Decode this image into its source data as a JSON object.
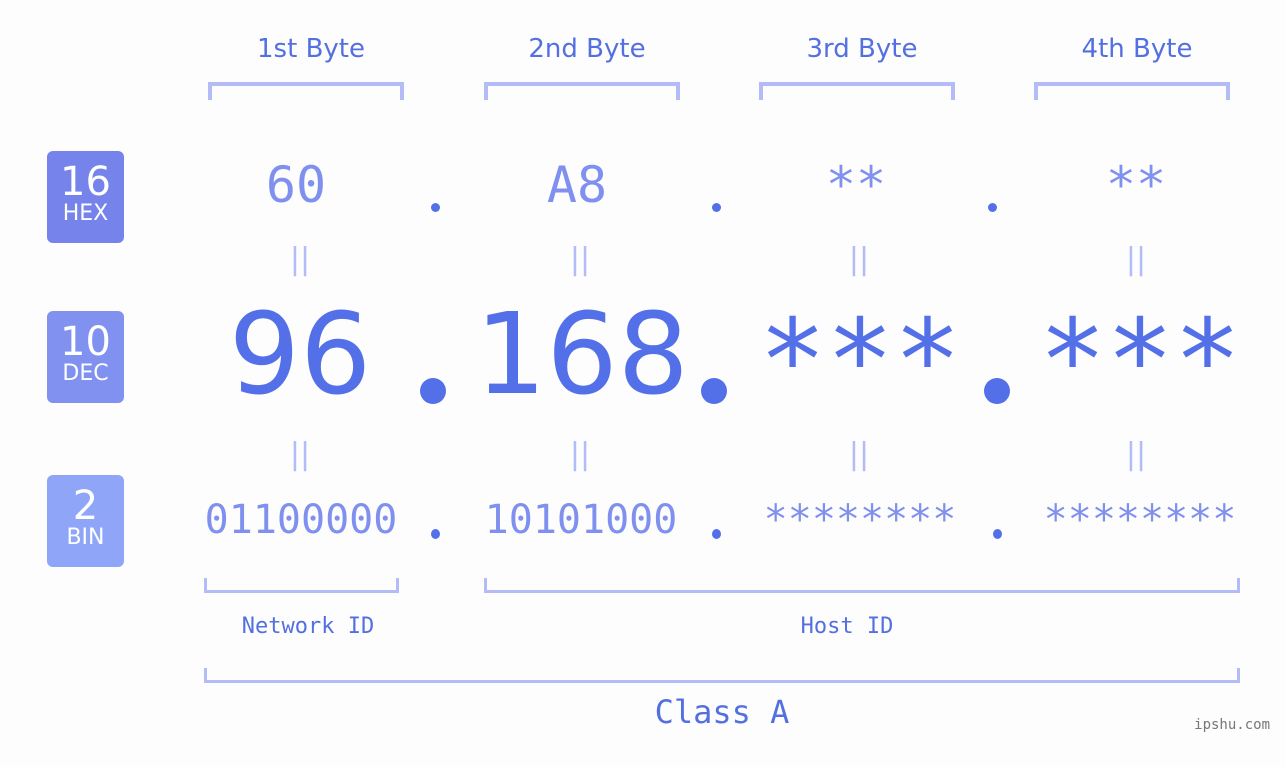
{
  "bytes": [
    {
      "header": "1st Byte",
      "hex": "60",
      "dec": "96",
      "bin": "01100000"
    },
    {
      "header": "2nd Byte",
      "hex": "A8",
      "dec": "168",
      "bin": "10101000"
    },
    {
      "header": "3rd Byte",
      "hex": "**",
      "dec": "***",
      "bin": "********"
    },
    {
      "header": "4th Byte",
      "hex": "**",
      "dec": "***",
      "bin": "********"
    }
  ],
  "badges": {
    "hex": {
      "number": "16",
      "label": "HEX",
      "color": "#7583ea"
    },
    "dec": {
      "number": "10",
      "label": "DEC",
      "color": "#8091f0"
    },
    "bin": {
      "number": "2",
      "label": "BIN",
      "color": "#8fa6f8"
    }
  },
  "equals_symbol": "||",
  "segments": {
    "network": "Network ID",
    "host": "Host ID",
    "class": "Class A"
  },
  "watermark": "ipshu.com",
  "colors": {
    "accent": "#5470e8",
    "light": "#8090ee",
    "bracket": "#b3bcf6"
  }
}
